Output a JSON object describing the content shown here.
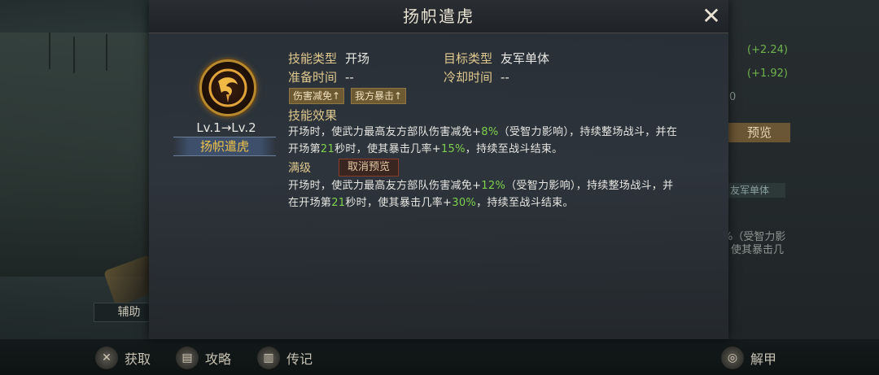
{
  "modal": {
    "title": "扬帜遣虎",
    "close_icon": "close-icon",
    "skill": {
      "level_text": "Lv.1→Lv.2",
      "name": "扬帜遣虎"
    },
    "info": {
      "skill_type_label": "技能类型",
      "skill_type_value": "开场",
      "target_type_label": "目标类型",
      "target_type_value": "友军单体",
      "prep_time_label": "准备时间",
      "prep_time_value": "--",
      "cooldown_label": "冷却时间",
      "cooldown_value": "--"
    },
    "tags": [
      "伤害减免↑",
      "我方暴击↑"
    ],
    "effect": {
      "heading": "技能效果",
      "line1_a": "开场时，使武力最高友方部队伤害减免+",
      "line1_val": "8%",
      "line1_b": "（受智力影响），持续整场战斗，并在",
      "line2_a": "开场第",
      "line2_val1": "21",
      "line2_b": "秒时，使其暴击几率+",
      "line2_val2": "15%",
      "line2_c": "，持续至战斗结束。"
    },
    "max_level": {
      "heading": "满级",
      "cancel_preview": "取消预览",
      "line1_a": "开场时，使武力最高友方部队伤害减免+",
      "line1_val": "12%",
      "line1_b": "（受智力影响），持续整场战斗，并",
      "line2_a": "在开场第",
      "line2_val1": "21",
      "line2_b": "秒时，使其暴击几率+",
      "line2_val2": "30%",
      "line2_c": "，持续至战斗结束。"
    }
  },
  "background": {
    "right_green_1": "(+2.24)",
    "right_green_2": "(+1.92)",
    "right_num": "0",
    "preview_button": "预览",
    "target_tag": "友军单体",
    "desc_line1": "%（受智力影",
    "desc_line2": "使其暴击几",
    "assist_label": "辅助"
  },
  "bottom_bar": {
    "items": [
      {
        "label": "获取",
        "icon": "acquire-icon"
      },
      {
        "label": "攻略",
        "icon": "guide-icon"
      },
      {
        "label": "传记",
        "icon": "biography-icon"
      },
      {
        "label": "解甲",
        "icon": "disarm-icon"
      }
    ]
  }
}
